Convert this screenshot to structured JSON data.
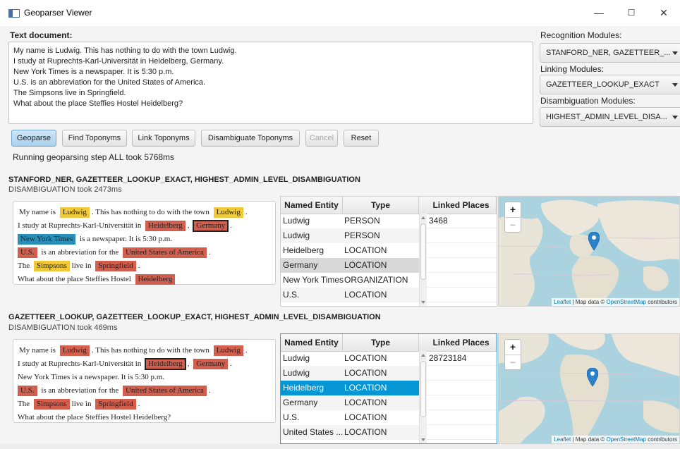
{
  "window": {
    "title": "Geoparser Viewer",
    "min": "—",
    "max": "☐",
    "close": "✕"
  },
  "doc": {
    "label": "Text document:",
    "lines": [
      "My name is Ludwig. This has nothing to do with the town Ludwig.",
      "I study at Ruprechts-Karl-Universität in Heidelberg, Germany.",
      "New York Times is a newspaper. It is 5:30 p.m.",
      "U.S. is an abbreviation for the United States of America.",
      "The Simpsons live in Springfield.",
      "What about the place Steffies Hostel Heidelberg?"
    ]
  },
  "modules": {
    "recognition_label": "Recognition Modules:",
    "recognition_value": "STANFORD_NER, GAZETTEER_...",
    "linking_label": "Linking Modules:",
    "linking_value": "GAZETTEER_LOOKUP_EXACT",
    "disambiguation_label": "Disambiguation Modules:",
    "disambiguation_value": "HIGHEST_ADMIN_LEVEL_DISA..."
  },
  "buttons": {
    "geoparse": "Geoparse",
    "find": "Find Toponyms",
    "link": "Link Toponyms",
    "disambiguate": "Disambiguate Toponyms",
    "cancel": "Cancel",
    "reset": "Reset"
  },
  "status": "Running geoparsing step ALL took 5768ms",
  "table_headers": {
    "entity": "Named Entity",
    "type": "Type",
    "linked": "Linked Places"
  },
  "map": {
    "zoom_in": "+",
    "zoom_out": "−",
    "attr_leaflet": "Leaflet",
    "attr_mid": " | Map data © ",
    "attr_osm": "OpenStreetMap",
    "attr_end": " contributors"
  },
  "results": [
    {
      "title": "STANFORD_NER, GAZETTEER_LOOKUP_EXACT, HIGHEST_ADMIN_LEVEL_DISAMBIGUATION",
      "subtitle": "DISAMBIGUATION took 2473ms",
      "text": {
        "l1a": "My name is",
        "l1b": "Ludwig",
        "l1c": ". This has nothing to do with the town",
        "l1d": "Ludwig",
        "l1e": ".",
        "l2a": "I study at Ruprechts-Karl-Universität in",
        "l2b": "Heidelberg",
        "l2c": ",",
        "l2d": "Germany",
        "l2e": ".",
        "l3a": "New York Times",
        "l3b": "is a newspaper. It is 5:30 p.m.",
        "l4a": "U.S.",
        "l4b": "is an abbreviation for the",
        "l4c": "United States of America",
        "l4d": ".",
        "l5a": "The",
        "l5b": "Simpsons",
        "l5c": "live in",
        "l5d": "Springfield",
        "l5e": ".",
        "l6a": "What about the place Steffies Hostel",
        "l6b": "Heidelberg"
      },
      "rows": [
        {
          "entity": "Ludwig",
          "type": "PERSON"
        },
        {
          "entity": "Ludwig",
          "type": "PERSON"
        },
        {
          "entity": "Heidelberg",
          "type": "LOCATION"
        },
        {
          "entity": "Germany",
          "type": "LOCATION"
        },
        {
          "entity": "New York Times",
          "type": "ORGANIZATION"
        },
        {
          "entity": "U.S.",
          "type": "LOCATION"
        }
      ],
      "linked": "3468"
    },
    {
      "title": "GAZETTEER_LOOKUP, GAZETTEER_LOOKUP_EXACT, HIGHEST_ADMIN_LEVEL_DISAMBIGUATION",
      "subtitle": "DISAMBIGUATION took 469ms",
      "text": {
        "l1a": "My name is",
        "l1b": "Ludwig",
        "l1c": ". This has nothing to do with the town",
        "l1d": "Ludwig",
        "l1e": ".",
        "l2a": "I study at Ruprechts-Karl-Universität in",
        "l2b": "Heidelberg",
        "l2c": ",",
        "l2d": "Germany",
        "l2e": ".",
        "l3a": "New York Times is a newspaper. It is 5:30 p.m.",
        "l4a": "U.S.",
        "l4b": "is an abbreviation for the",
        "l4c": "United States of America",
        "l4d": ".",
        "l5a": "The",
        "l5b": "Simpsons",
        "l5c": "live in",
        "l5d": "Springfield",
        "l5e": ".",
        "l6a": "What about the place Steffies Hostel Heidelberg?"
      },
      "rows": [
        {
          "entity": "Ludwig",
          "type": "LOCATION"
        },
        {
          "entity": "Ludwig",
          "type": "LOCATION"
        },
        {
          "entity": "Heidelberg",
          "type": "LOCATION"
        },
        {
          "entity": "Germany",
          "type": "LOCATION"
        },
        {
          "entity": "U.S.",
          "type": "LOCATION"
        },
        {
          "entity": "United States ...",
          "type": "LOCATION"
        }
      ],
      "linked": "28723184"
    }
  ],
  "colors": {
    "person": "#f0c93a",
    "location": "#d25e4e",
    "organization": "#2a8fb8",
    "selection": "#0596d3",
    "marker": "#2b82cb"
  }
}
